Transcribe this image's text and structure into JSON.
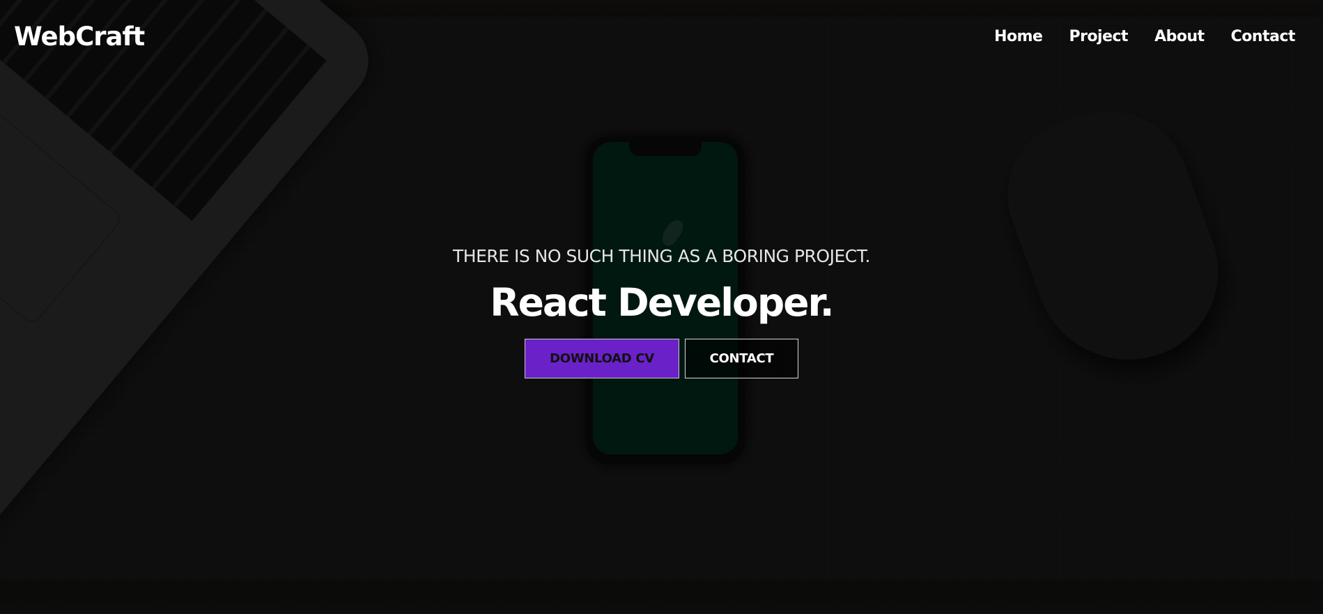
{
  "brand": {
    "logo": "WebCraft"
  },
  "nav": {
    "items": [
      {
        "label": "Home"
      },
      {
        "label": "Project"
      },
      {
        "label": "About"
      },
      {
        "label": "Contact"
      }
    ]
  },
  "hero": {
    "tagline": "THERE IS NO SUCH THING AS A BORING PROJECT.",
    "title": "React Developer.",
    "primary_button": "DOWNLOAD CV",
    "secondary_button": "CONTACT"
  },
  "colors": {
    "accent": "#6b21c8",
    "text": "#ffffff",
    "background": "#111010"
  },
  "background_image": {
    "objects": [
      "laptop",
      "phone",
      "mouse"
    ]
  }
}
